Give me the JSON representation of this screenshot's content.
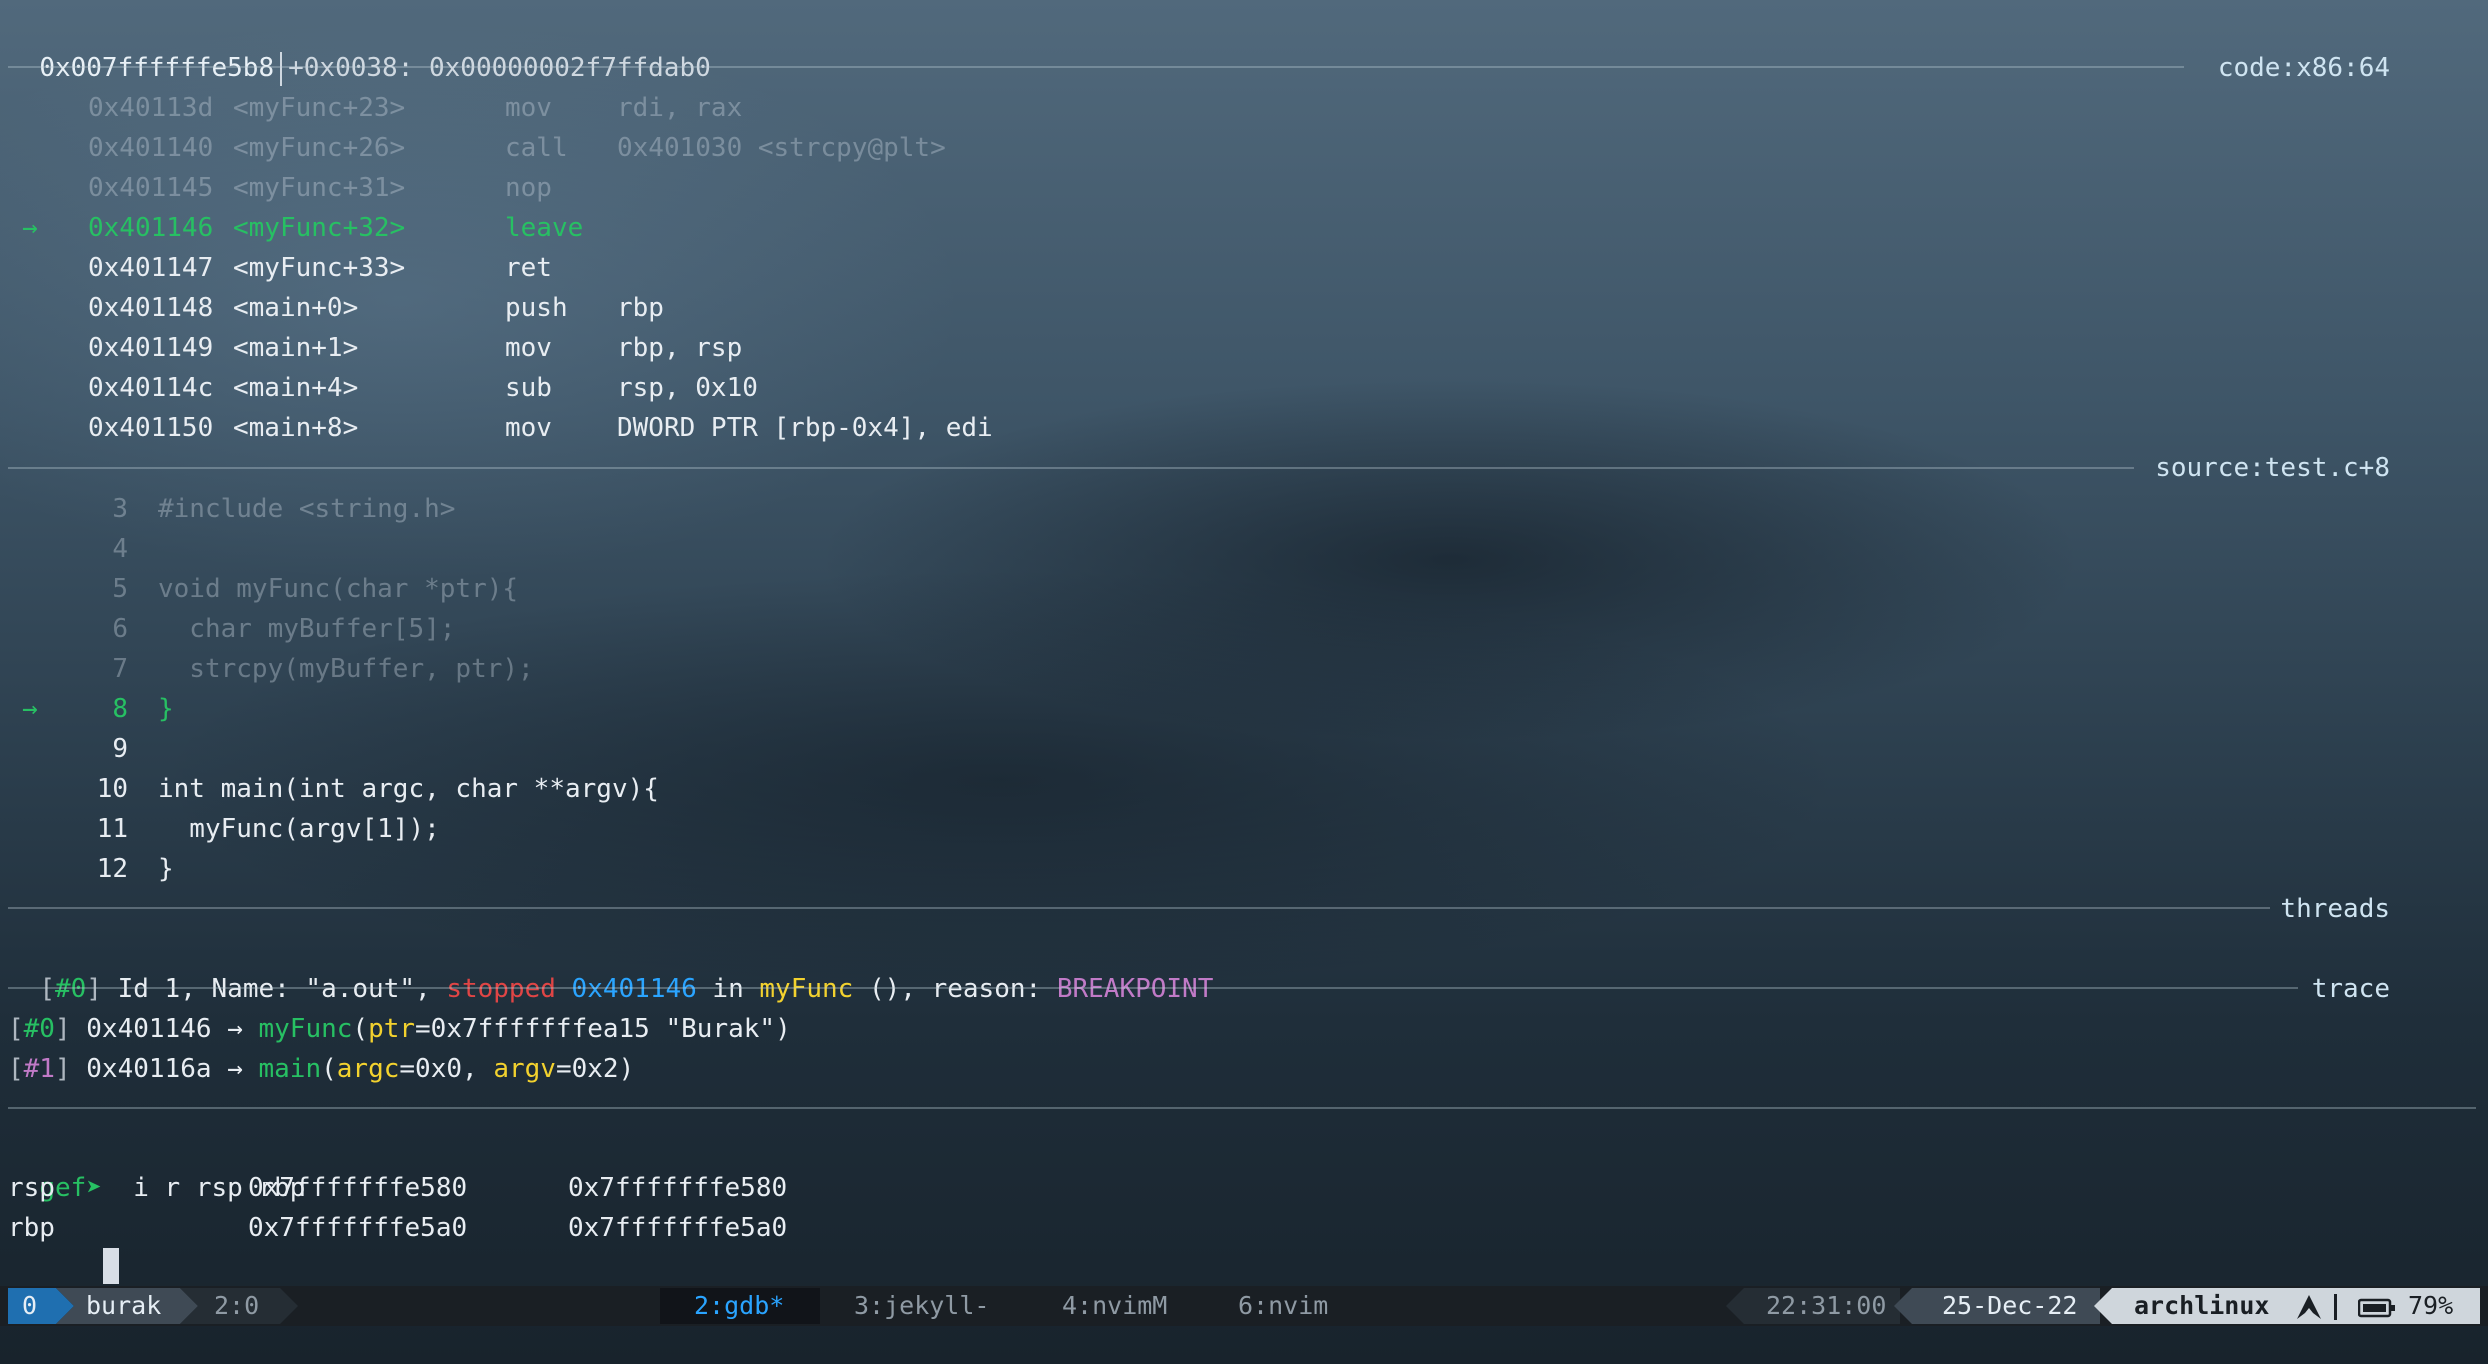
{
  "top_line": {
    "addr": "0x007ffffffe5b8",
    "rest": "+0x0038: 0x00000002f7ffdab0"
  },
  "code": {
    "label": "code:x86:64",
    "lines": [
      {
        "marker": "",
        "addr": "0x40113d",
        "sym": "<myFunc+23>",
        "op": "mov",
        "args": "rdi, rax",
        "style": "faded"
      },
      {
        "marker": "",
        "addr": "0x401140",
        "sym": "<myFunc+26>",
        "op": "call",
        "args": "0x401030 <strcpy@plt>",
        "style": "faded"
      },
      {
        "marker": "",
        "addr": "0x401145",
        "sym": "<myFunc+31>",
        "op": "nop",
        "args": "",
        "style": "faded"
      },
      {
        "marker": "→",
        "addr": "0x401146",
        "sym": "<myFunc+32>",
        "op": "leave",
        "args": "",
        "style": "green"
      },
      {
        "marker": "",
        "addr": "0x401147",
        "sym": "<myFunc+33>",
        "op": "ret",
        "args": "",
        "style": "bright"
      },
      {
        "marker": "",
        "addr": "0x401148",
        "sym": "<main+0>",
        "op": "push",
        "args": "rbp",
        "style": "bright"
      },
      {
        "marker": "",
        "addr": "0x401149",
        "sym": "<main+1>",
        "op": "mov",
        "args": "rbp, rsp",
        "style": "bright"
      },
      {
        "marker": "",
        "addr": "0x40114c",
        "sym": "<main+4>",
        "op": "sub",
        "args": "rsp, 0x10",
        "style": "bright"
      },
      {
        "marker": "",
        "addr": "0x401150",
        "sym": "<main+8>",
        "op": "mov",
        "args": "DWORD PTR [rbp-0x4], edi",
        "style": "bright"
      }
    ]
  },
  "source": {
    "label": "source:test.c+8",
    "lines": [
      {
        "marker": "",
        "num": "3",
        "text": "#include <string.h>",
        "style": "faded"
      },
      {
        "marker": "",
        "num": "4",
        "text": "",
        "style": "faded"
      },
      {
        "marker": "",
        "num": "5",
        "text": "void myFunc(char *ptr){",
        "style": "faded"
      },
      {
        "marker": "",
        "num": "6",
        "text": "  char myBuffer[5];",
        "style": "faded"
      },
      {
        "marker": "",
        "num": "7",
        "text": "  strcpy(myBuffer, ptr);",
        "style": "faded"
      },
      {
        "marker": "→",
        "num": "8",
        "text": "}",
        "style": "green"
      },
      {
        "marker": "",
        "num": "9",
        "text": "",
        "style": "bright"
      },
      {
        "marker": "",
        "num": "10",
        "text": "int main(int argc, char **argv){",
        "style": "bright"
      },
      {
        "marker": "",
        "num": "11",
        "text": "  myFunc(argv[1]);",
        "style": "bright"
      },
      {
        "marker": "",
        "num": "12",
        "text": "}",
        "style": "bright"
      }
    ]
  },
  "threads": {
    "label": "threads",
    "index": "#0",
    "pre": " Id 1, Name: \"a.out\", ",
    "state": "stopped",
    "addr": "0x401146",
    "in": " in ",
    "func": "myFunc",
    "post": " (), reason: ",
    "reason": "BREAKPOINT"
  },
  "trace": {
    "label": "trace",
    "frames": [
      {
        "index": "#0",
        "addr": "0x401146",
        "arrow": "→",
        "func": "myFunc",
        "args": [
          {
            "name": "ptr",
            "value": "=0x7fffffffea15 \"Burak\""
          }
        ]
      },
      {
        "index": "#1",
        "addr": "0x40116a",
        "arrow": "→",
        "func": "main",
        "args": [
          {
            "name": "argc",
            "value": "=0x0"
          },
          {
            "name": "argv",
            "value": "=0x2"
          }
        ]
      }
    ]
  },
  "console": {
    "prompt": "gef➤",
    "command": "i r rsp rbp",
    "registers": [
      {
        "name": "rsp",
        "hex": "0x7fffffffe580",
        "value": "0x7fffffffe580"
      },
      {
        "name": "rbp",
        "hex": "0x7fffffffe5a0",
        "value": "0x7fffffffe5a0"
      }
    ]
  },
  "statusbar": {
    "session": "0",
    "user": "burak",
    "pane": "2:0",
    "windows": [
      {
        "label": "2:gdb*",
        "active": true
      },
      {
        "label": "3:jekyll-",
        "active": false
      },
      {
        "label": "4:nvimM",
        "active": false
      },
      {
        "label": "6:nvim",
        "active": false
      }
    ],
    "time": "22:31:00",
    "date": "25-Dec-22",
    "host": "archlinux",
    "battery": "79%"
  },
  "colors": {
    "accent_green": "#27c063",
    "accent_blue": "#2aa4ff",
    "accent_yellow": "#f3d22e",
    "accent_red": "#e04545",
    "accent_purple": "#c17ac7",
    "statusbar_bg": "#1a1f24",
    "session_bg": "#1f6fb0",
    "user_bg": "#3f4a55"
  },
  "icons": {
    "arch_logo": "arch-linux-icon",
    "battery": "battery-icon",
    "pointer": "arrow-right-icon"
  }
}
